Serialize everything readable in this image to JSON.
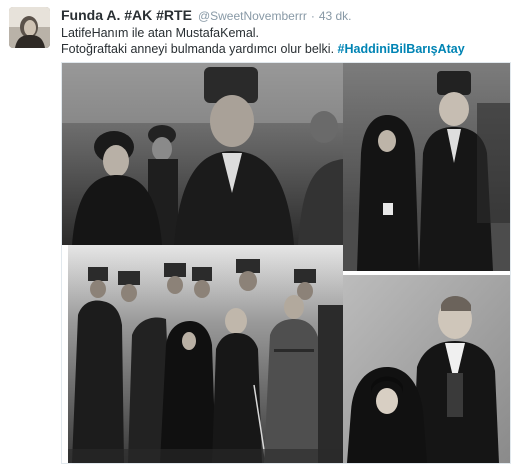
{
  "tweet": {
    "fullname": "Funda A. #AK #RTE",
    "username": "@SweetNovemberrr",
    "separator": "·",
    "time": "43 dk.",
    "text_line1": "LatifeHanım ile atan MustafaKemal.",
    "text_line2": "Fotoğraftaki anneyi bulmanda yardımcı olur belki.",
    "hashtag": "#HaddiniBilBarışAtay",
    "media_count": 4
  },
  "icons": {
    "avatar": "profile-photo-icon"
  }
}
